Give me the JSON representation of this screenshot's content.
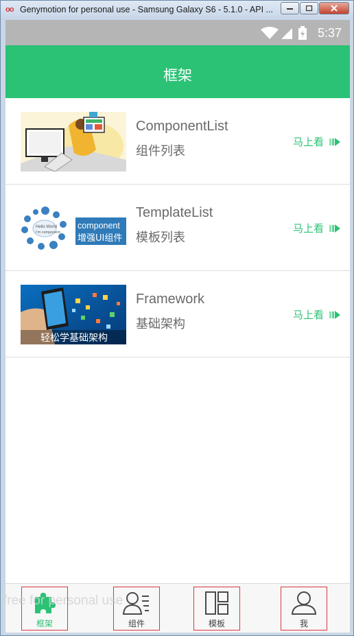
{
  "window": {
    "title": "Genymotion for personal use - Samsung Galaxy S6 - 5.1.0 - API ...",
    "logo": "oo",
    "minimize_icon": "minimize-icon",
    "maximize_icon": "maximize-icon",
    "close_icon": "close-icon"
  },
  "statusbar": {
    "time": "5:37",
    "icons": [
      "wifi-icon",
      "signal-icon",
      "battery-icon"
    ]
  },
  "appbar": {
    "title": "框架"
  },
  "list": [
    {
      "title": "ComponentList",
      "subtitle": "组件列表",
      "action": "马上看",
      "thumb": "component-illustration"
    },
    {
      "title": "TemplateList",
      "subtitle": "模板列表",
      "action": "马上看",
      "thumb": "component-diagram",
      "thumb_text": [
        "component",
        "增强UI组件",
        "Hello World",
        "I'm component"
      ]
    },
    {
      "title": "Framework",
      "subtitle": "基础架构",
      "action": "马上看",
      "thumb": "framework-photo",
      "thumb_text": [
        "轻松学基础架构"
      ]
    }
  ],
  "tabs": [
    {
      "label": "框架",
      "icon": "puzzle-icon",
      "active": true
    },
    {
      "label": "组件",
      "icon": "contact-list-icon",
      "active": false
    },
    {
      "label": "模板",
      "icon": "layout-icon",
      "active": false
    },
    {
      "label": "我",
      "icon": "user-icon",
      "active": false
    }
  ],
  "watermark": "free for personal use",
  "colors": {
    "accent": "#2bc275",
    "statusbar": "#b5b5b5",
    "tab_outline": "#d9363e"
  }
}
